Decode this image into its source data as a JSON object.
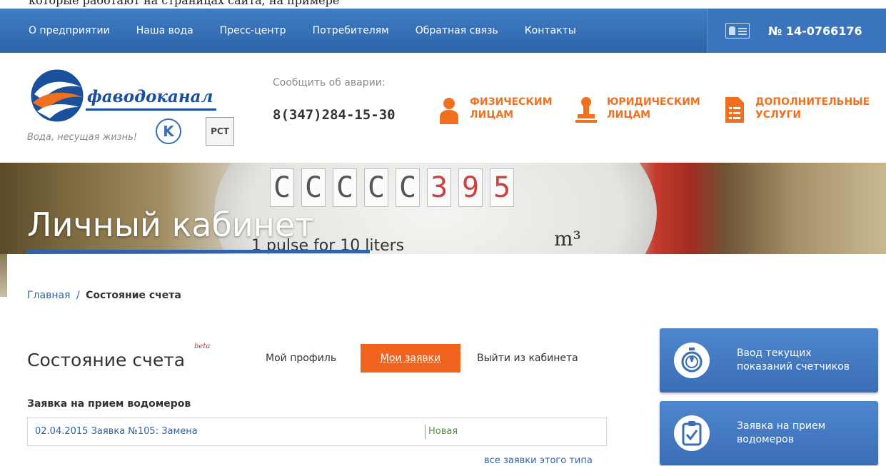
{
  "top_clip_text": "которые работают на страницах сайта, на примере",
  "nav": {
    "items": [
      {
        "label": "О предприятии"
      },
      {
        "label": "Наша вода"
      },
      {
        "label": "Пресс-центр"
      },
      {
        "label": "Потребителям"
      },
      {
        "label": "Обратная связь"
      },
      {
        "label": "Контакты"
      }
    ],
    "account_number": "№ 14-0766176"
  },
  "logo": {
    "name": "фаводоканал",
    "slogan": "Вода, несущая жизнь!",
    "cert_k": "K",
    "cert_rst": "РСТ"
  },
  "emergency": {
    "label": "Сообщить об аварии:",
    "phone": "8(347)284-15-30"
  },
  "services": [
    {
      "line1": "ФИЗИЧЕСКИМ",
      "line2": "ЛИЦАМ"
    },
    {
      "line1": "ЮРИДИЧЕСКИМ",
      "line2": "ЛИЦАМ"
    },
    {
      "line1": "ДОПОЛНИТЕЛЬНЫЕ",
      "line2": "УСЛУГИ"
    }
  ],
  "banner": {
    "title": "Личный кабинет",
    "digits": [
      "C",
      "C",
      "C",
      "C",
      "C",
      "3",
      "9",
      "5"
    ],
    "pulse_text": "1 pulse for 10 liters",
    "m3": "m³"
  },
  "breadcrumb": {
    "home": "Главная",
    "separator": "/",
    "current": "Состояние счета"
  },
  "page": {
    "title": "Состояние счета",
    "beta": "beta"
  },
  "tabs": {
    "profile": "Мой профиль",
    "requests": "Мои заявки",
    "logout": "Выйти из кабинета"
  },
  "requests_section": {
    "title": "Заявка на прием водомеров",
    "items": [
      {
        "description": "02.04.2015 Заявка №105: Замена",
        "status": "Новая"
      }
    ],
    "all_link": "все заявки этого типа"
  },
  "side_buttons": [
    {
      "line1": "Ввод текущих",
      "line2": "показаний счетчиков"
    },
    {
      "line1": "Заявка на прием",
      "line2": "водомеров"
    }
  ],
  "colors": {
    "nav_blue": "#2f64a8",
    "accent_orange": "#f0641e",
    "status_green": "#4e9a2c"
  }
}
